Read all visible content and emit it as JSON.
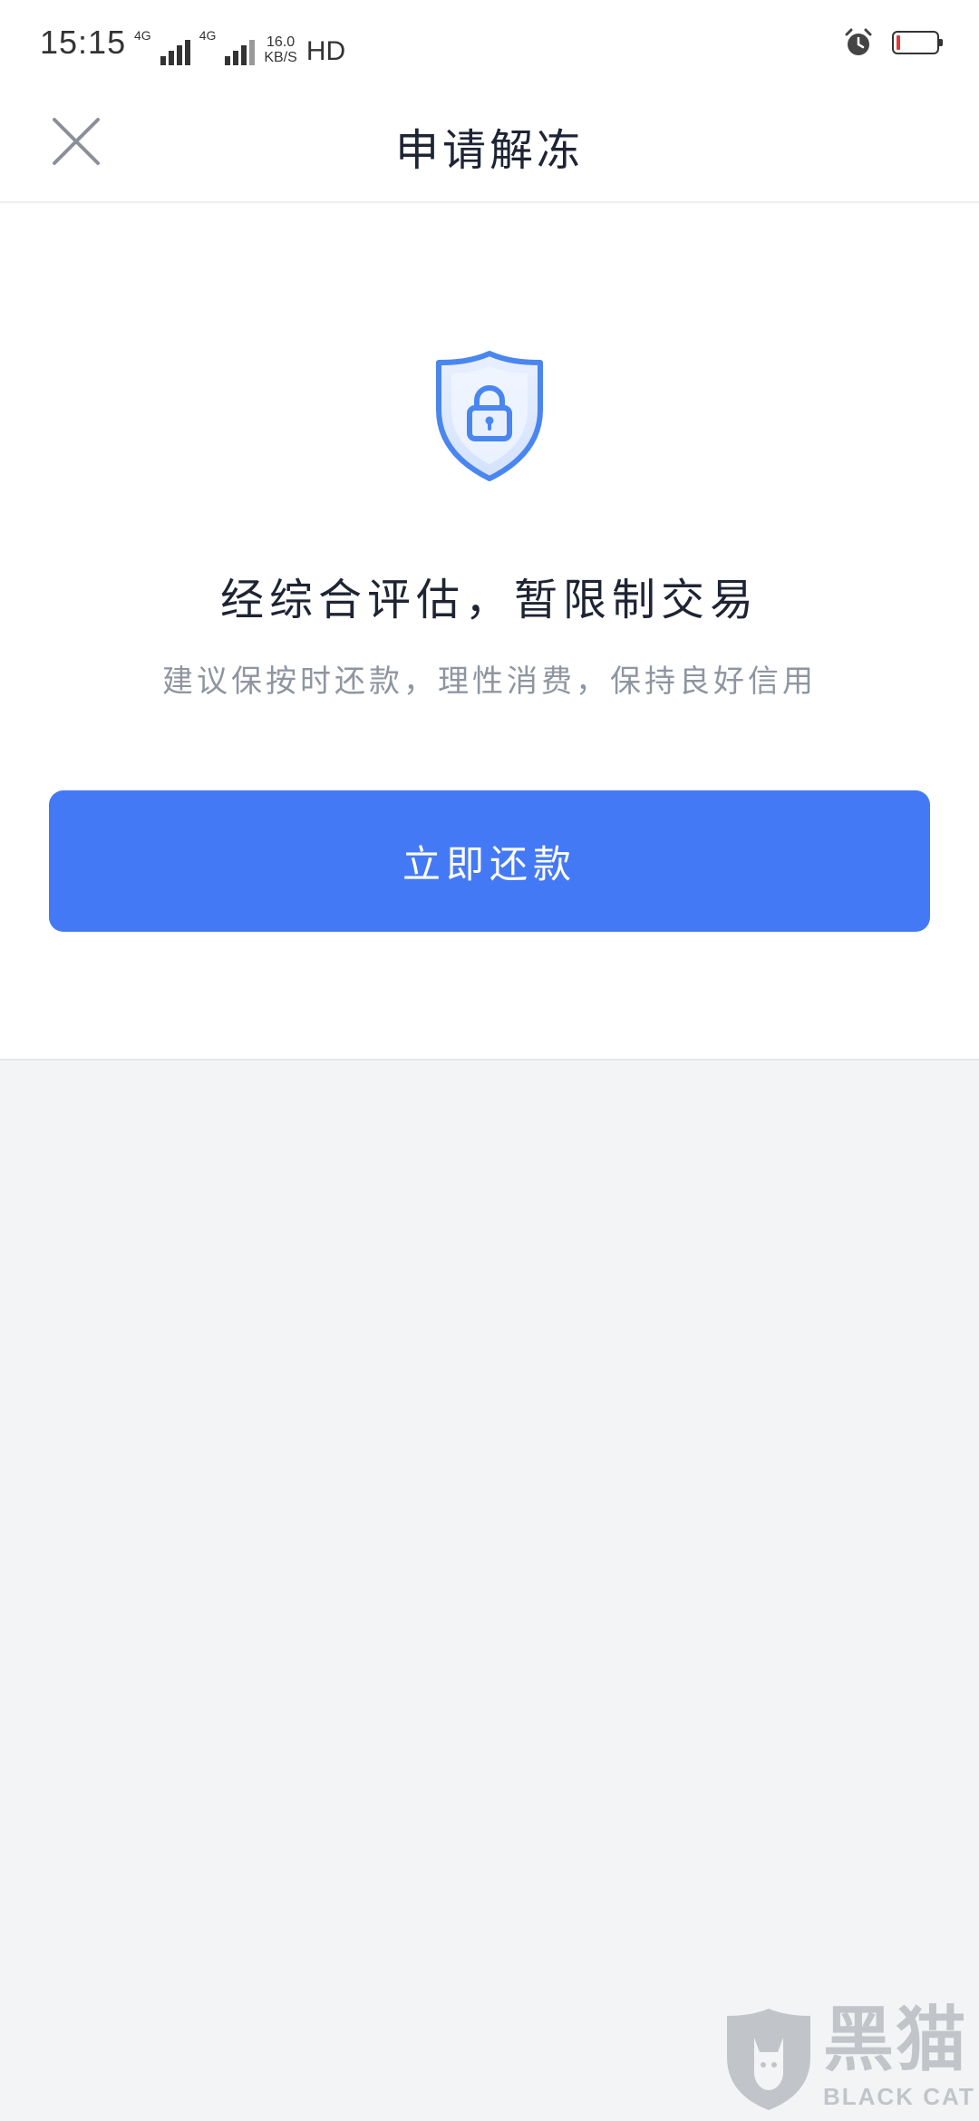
{
  "status_bar": {
    "time": "15:15",
    "net1": "4G",
    "net2": "4G",
    "speed_value": "16.0",
    "speed_unit": "KB/S",
    "hd": "HD"
  },
  "header": {
    "title": "申请解冻"
  },
  "main": {
    "message": "经综合评估，暂限制交易",
    "sub_message": "建议保按时还款，理性消费，保持良好信用",
    "button_label": "立即还款"
  },
  "watermark": {
    "cn": "黑猫",
    "en": "BLACK CAT"
  },
  "colors": {
    "primary": "#4479f6",
    "battery_low": "#e53935",
    "background": "#f3f4f5"
  },
  "icons": {
    "close": "close-icon",
    "shield": "shield-lock-icon",
    "alarm": "alarm-icon",
    "battery": "battery-icon"
  }
}
